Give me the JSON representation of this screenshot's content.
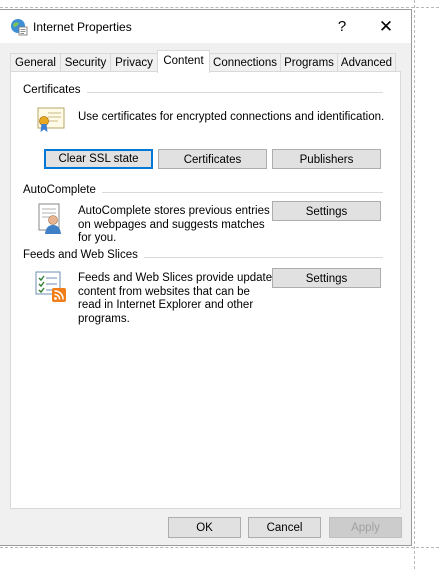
{
  "window": {
    "title": "Internet Properties",
    "help_glyph": "?",
    "close_glyph": "✕",
    "app_icon": "internet-globe-icon"
  },
  "tabs": [
    {
      "label": "General"
    },
    {
      "label": "Security"
    },
    {
      "label": "Privacy"
    },
    {
      "label": "Content",
      "active": true
    },
    {
      "label": "Connections"
    },
    {
      "label": "Programs"
    },
    {
      "label": "Advanced"
    }
  ],
  "certificates": {
    "heading": "Certificates",
    "description": "Use certificates for encrypted connections and identification.",
    "icon": "certificate-icon",
    "buttons": {
      "clear_ssl": "Clear SSL state",
      "certificates": "Certificates",
      "publishers": "Publishers"
    }
  },
  "autocomplete": {
    "heading": "AutoComplete",
    "description_lines": [
      "AutoComplete stores previous entries",
      "on webpages and suggests matches",
      "for you."
    ],
    "icon": "autocomplete-user-icon",
    "settings_label": "Settings"
  },
  "feeds": {
    "heading": "Feeds and Web Slices",
    "description_lines": [
      "Feeds and Web Slices provide updated",
      "content from websites that can be",
      "read in Internet Explorer and other",
      "programs."
    ],
    "icon": "feeds-rss-icon",
    "settings_label": "Settings"
  },
  "footer": {
    "ok": "OK",
    "cancel": "Cancel",
    "apply": "Apply"
  },
  "colors": {
    "accent": "#0078d7",
    "window_bg": "#f0f0f0",
    "button_bg": "#e1e1e1"
  }
}
